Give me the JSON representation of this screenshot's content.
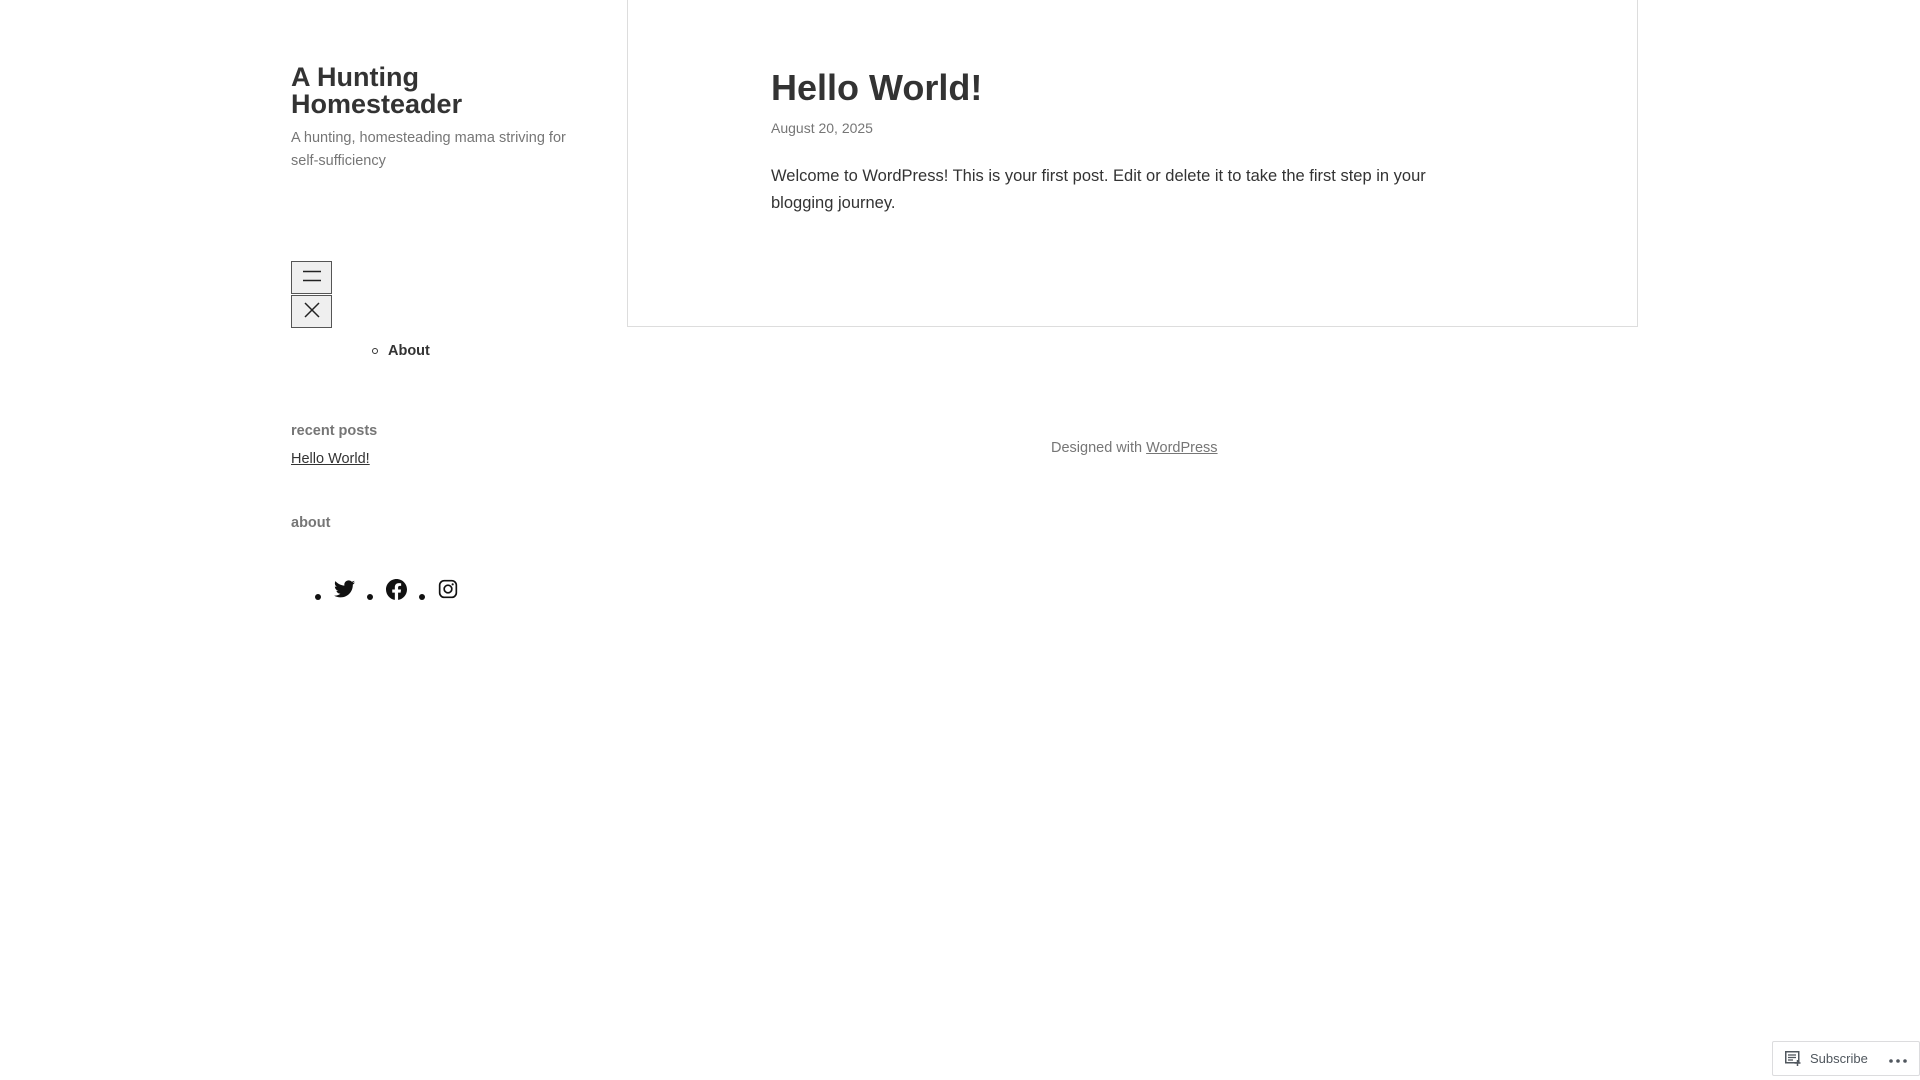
{
  "site": {
    "title": "A Hunting Homesteader",
    "tagline": "A hunting, homesteading mama striving for self-sufficiency"
  },
  "nav": {
    "open_icon": "hamburger-icon",
    "close_icon": "close-icon",
    "items": [
      {
        "label": "About"
      }
    ]
  },
  "widgets": {
    "recent_posts": {
      "title": "recent posts",
      "items": [
        {
          "label": "Hello World!"
        }
      ]
    },
    "about": {
      "title": "about"
    }
  },
  "social": {
    "icons": [
      "twitter-icon",
      "facebook-icon",
      "instagram-icon"
    ]
  },
  "post": {
    "title": "Hello World!",
    "date": "August 20, 2025",
    "body": "Welcome to WordPress! This is your first post. Edit or delete it to take the first step in your blogging journey."
  },
  "footer": {
    "prefix": "Designed with",
    "link_label": "WordPress"
  },
  "subscribe": {
    "label": "Subscribe",
    "icons": [
      "reader-icon",
      "ellipsis-icon"
    ]
  },
  "colors": {
    "text": "#333333",
    "muted": "#767676",
    "border": "#dddddd"
  }
}
